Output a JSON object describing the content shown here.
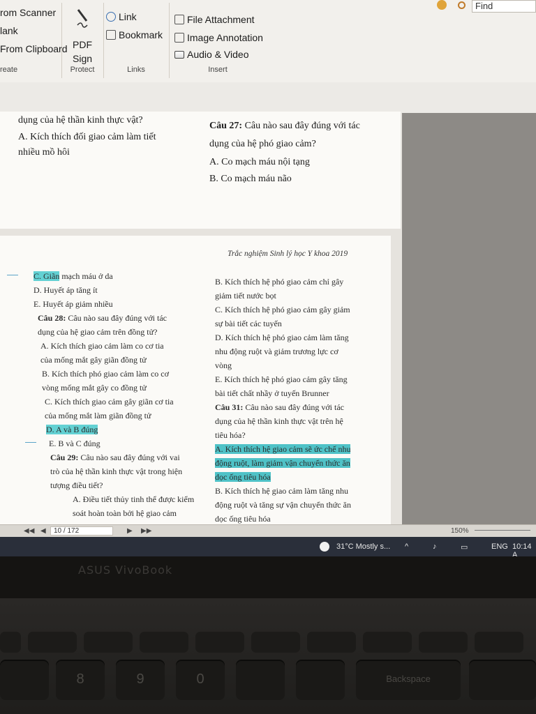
{
  "ribbon": {
    "create": {
      "items": [
        "rom Scanner",
        "lank",
        "From Clipboard"
      ],
      "label": "reate"
    },
    "protect": {
      "sign_line1": "PDF",
      "sign_line2": "Sign",
      "label": "Protect"
    },
    "links": {
      "items": [
        "Link",
        "Bookmark"
      ],
      "label": "Links"
    },
    "insert": {
      "items": [
        "File Attachment",
        "Image Annotation",
        "Audio & Video"
      ],
      "label": "Insert"
    },
    "find_placeholder": "Find"
  },
  "page1": {
    "left": [
      "dụng của hệ thần kinh thực vật?",
      "A. Kích thích đối giao cảm làm tiết",
      "nhiều mồ hôi"
    ],
    "right": {
      "q_label": "Câu 27:",
      "q_text": "Câu nào sau đây đúng với tác",
      "q_line2": "dụng của hệ phó giao cảm?",
      "options": [
        "A.  Co mạch máu nội tạng",
        "B.  Co mạch máu não"
      ]
    }
  },
  "page2": {
    "header": "Trắc nghiệm Sinh lý học Y khoa 2019",
    "left": {
      "c_hl": "C. Giãn",
      "c_rest": " mạch máu ở da",
      "d": "D.  Huyết áp tăng ít",
      "e": "E.  Huyết áp giảm nhiều",
      "q28_label": "Câu 28:",
      "q28_text": " Câu nào sau đây đúng với tác",
      "q28_line2": "dụng của hệ giao cảm trên đồng tử?",
      "a1": "A.  Kích thích giao cảm làm co cơ tia",
      "a2": "của mống mắt gây giãn đồng tử",
      "b1": "B.  Kích thích phó giao cảm làm co cơ",
      "b2": "vòng mống mắt gây co đồng tử",
      "c1": "C.  Kích thích giao cảm gây giãn cơ tia",
      "c2": "của mống mắt làm giãn đồng tử",
      "d_ans": "D.  A và B đúng",
      "e_ans": "E.  B và C đúng",
      "q29_label": "Câu 29:",
      "q29_text": " Câu nào sau đây đúng với vai",
      "q29_line2": "trò của hệ thần kinh thực vật trong hiện",
      "q29_line3": "tượng điều tiết?",
      "q29_a": "A.  Điều tiết thủy tinh thể được kiểm",
      "q29_a2": "soát hoàn toàn bởi hệ giao cảm"
    },
    "right": {
      "b1": "B.  Kích thích hệ phó giao cảm chỉ gây",
      "b2": "giảm tiết nước bọt",
      "c1": "C.  Kích thích hệ phó giao cảm gây giảm",
      "c2": "sự bài tiết các tuyến",
      "d1": "D.  Kích thích hệ phó giao cảm làm tăng",
      "d2": "nhu động ruột và giảm trương lực cơ",
      "d3": "vòng",
      "e1": "E.  Kích thích hệ phó giao cảm gây tăng",
      "e2": "bài tiết chất nhầy ở tuyến Brunner",
      "q31_label": "Câu 31:",
      "q31_text": " Câu nào sau đây đúng với tác",
      "q31_line2": "dụng của hệ thần kinh thực vật trên hệ",
      "q31_line3": "tiêu hóa?",
      "a1": "A.  Kích thích hệ giao cảm sẽ ức chế nhu",
      "a2": "động ruột, làm giảm vận chuyển thức ăn",
      "a3": "dọc ống tiêu hóa",
      "b31_1": "B.  Kích thích hệ giao cảm làm tăng nhu",
      "b31_2": "động ruột và tăng sự vận chuyển thức ăn",
      "b31_3": "dọc ống tiêu hóa"
    }
  },
  "status": {
    "page": "10 / 172",
    "zoom": "150%"
  },
  "taskbar": {
    "weather": "31°C  Mostly s...",
    "lang": "ENG",
    "time": "10:14 A"
  },
  "laptop": {
    "brand": "ASUS VivoBook",
    "keys": [
      "8",
      "9",
      "0",
      "Backspace"
    ]
  },
  "colors": {
    "highlight": "#63d1d3"
  }
}
